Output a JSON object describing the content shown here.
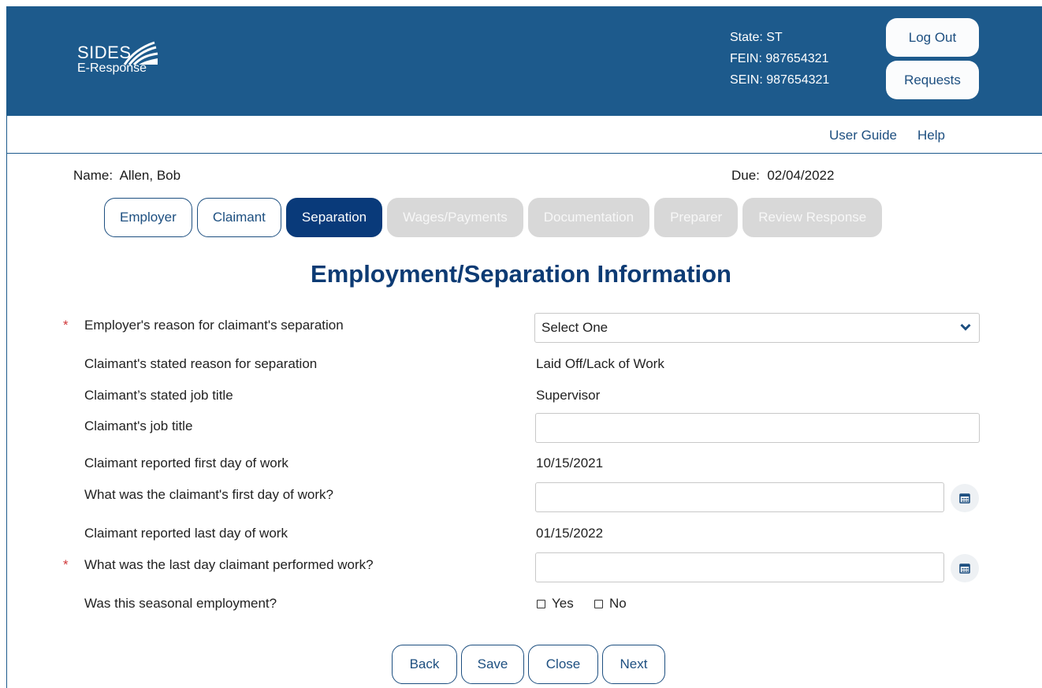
{
  "header": {
    "logo_main": "SIDES",
    "logo_sub": "E-Response",
    "state": "State: ST",
    "fein": "FEIN: 987654321",
    "sein": "SEIN: 987654321",
    "logout_label": "Log Out",
    "requests_label": "Requests"
  },
  "top_links": {
    "user_guide": "User Guide",
    "help": "Help"
  },
  "claimant": {
    "name": "Name:  Allen, Bob",
    "due": "Due:  02/04/2022"
  },
  "tabs": [
    {
      "label": "Employer",
      "state": "inactive"
    },
    {
      "label": "Claimant",
      "state": "inactive"
    },
    {
      "label": "Separation",
      "state": "active"
    },
    {
      "label": "Wages/Payments",
      "state": "disabled"
    },
    {
      "label": "Documentation",
      "state": "disabled"
    },
    {
      "label": "Preparer",
      "state": "disabled"
    },
    {
      "label": "Review Response",
      "state": "disabled"
    }
  ],
  "page_title": "Employment/Separation Information",
  "form": {
    "required_marker": "*",
    "employer_reason_label": "Employer's reason for claimant's separation",
    "employer_reason_value": "Select One",
    "claimant_reason_label": "Claimant's stated reason for separation",
    "claimant_reason_value": "Laid Off/Lack of Work",
    "claimant_stated_title_label": "Claimant’s stated job title",
    "claimant_stated_title_value": "Supervisor",
    "job_title_label": "Claimant's job title",
    "job_title_value": "",
    "reported_first_label": "Claimant reported first day of work",
    "reported_first_value": "10/15/2021",
    "first_day_label": "What was the claimant's first day of work?",
    "first_day_value": "",
    "reported_last_label": "Claimant reported last day of work",
    "reported_last_value": "01/15/2022",
    "last_day_label": "What was the last day claimant performed work?",
    "last_day_value": "",
    "seasonal_label": "Was this seasonal employment?",
    "seasonal_yes": "Yes",
    "seasonal_no": "No"
  },
  "buttons": {
    "back": "Back",
    "save": "Save",
    "close": "Close",
    "next": "Next"
  },
  "colors": {
    "header_bg": "#1d5a8c",
    "active_tab": "#093a7a",
    "title": "#0d3b74",
    "required": "#d0393b"
  },
  "icons": {
    "logo": "sides-swoosh-logo",
    "select": "chevron-down-icon",
    "date": "calendar-icon"
  }
}
